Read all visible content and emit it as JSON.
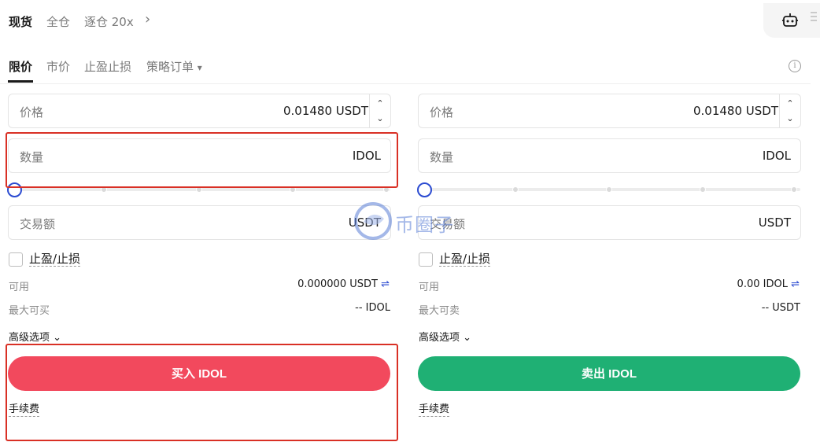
{
  "header": {
    "modes": [
      "现货",
      "全仓",
      "逐仓 20x"
    ],
    "chevron": "›"
  },
  "order_tabs": {
    "items": [
      "限价",
      "市价",
      "止盈止损",
      "策略订单"
    ],
    "dropdown_caret": "▾",
    "info": "i"
  },
  "buy": {
    "price_label": "价格",
    "price_value": "0.01480 USDT",
    "amount_label": "数量",
    "amount_unit": "IDOL",
    "total_label": "交易额",
    "total_unit": "USDT",
    "tp_sl_label": "止盈/止损",
    "available_label": "可用",
    "available_value": "0.000000 USDT",
    "max_label": "最大可买",
    "max_value": "-- IDOL",
    "advanced_label": "高级选项",
    "button_label": "买入 IDOL",
    "fee_label": "手续费"
  },
  "sell": {
    "price_label": "价格",
    "price_value": "0.01480 USDT",
    "amount_label": "数量",
    "amount_unit": "IDOL",
    "total_label": "交易额",
    "total_unit": "USDT",
    "tp_sl_label": "止盈/止损",
    "available_label": "可用",
    "available_value": "0.00 IDOL",
    "max_label": "最大可卖",
    "max_value": "-- USDT",
    "advanced_label": "高级选项",
    "button_label": "卖出 IDOL",
    "fee_label": "手续费"
  },
  "stepper": {
    "up": "⌃",
    "down": "⌄"
  },
  "swap_icon_glyph": "⇌",
  "advanced_caret": "⌄",
  "watermark": {
    "text": "币圈子"
  },
  "colors": {
    "buy": "#f2495d",
    "sell": "#1fb074",
    "slider_knob": "#2b4bd1",
    "annotation": "#d93025"
  }
}
